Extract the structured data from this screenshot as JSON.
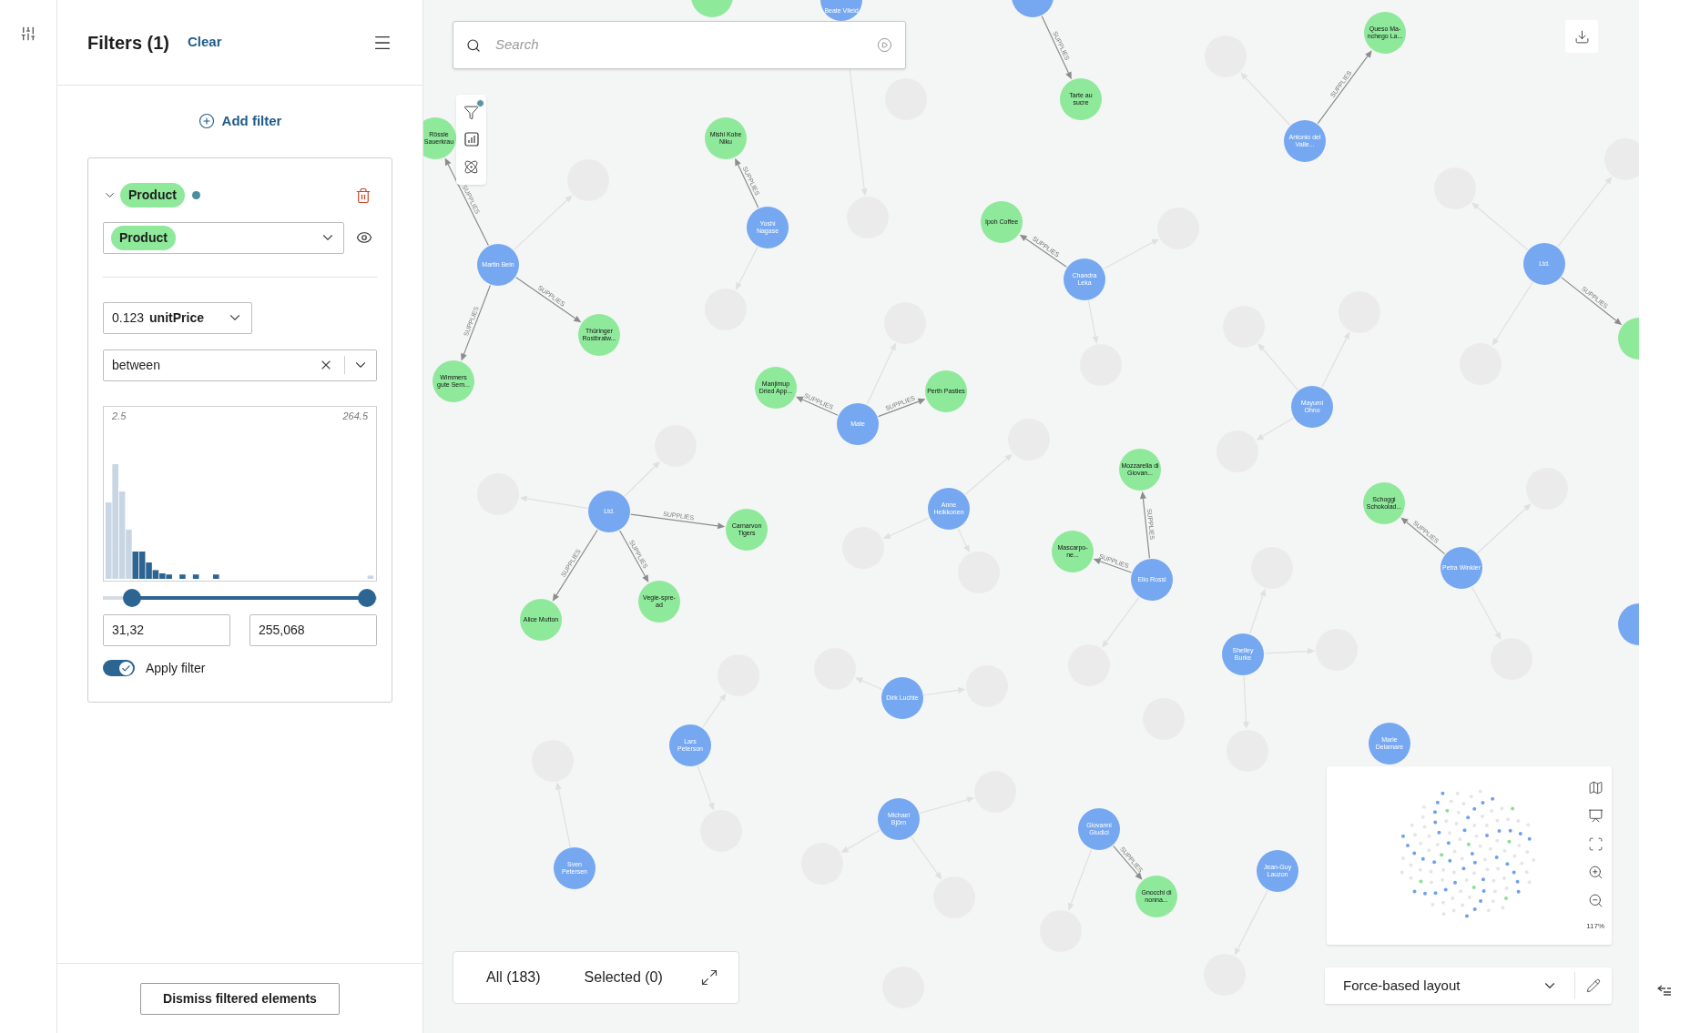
{
  "filters_panel": {
    "title": "Filters (1)",
    "clear_link": "Clear",
    "add_filter": "Add filter",
    "filter": {
      "expanded": true,
      "label_badge": "Product",
      "active": true,
      "label_select": "Product",
      "property_type": "0.123",
      "property": "unitPrice",
      "operator": "between",
      "histogram": {
        "min_label": "2.5",
        "max_label": "264.5"
      },
      "slider": {
        "thumbs": [
          {
            "level": 0.106
          },
          {
            "level": 0.965
          }
        ]
      },
      "min_value": "31,32",
      "max_value": "255,068",
      "apply_filter": {
        "label": "Apply filter",
        "on": true
      }
    },
    "dismiss_button": "Dismiss filtered elements"
  },
  "search": {
    "placeholder": "Search"
  },
  "toolbar": {
    "filter_badge": true
  },
  "graph": {
    "nodes": [
      {
        "kind": "product"
      },
      {
        "kind": "supplier"
      },
      {
        "label": "Beate Vileid",
        "kind": "supplier"
      },
      {
        "label": "Queso Ma-nchego La...",
        "kind": "product"
      },
      {
        "label": "Tarte au sucre",
        "kind": "product"
      },
      {
        "label": "Rössle Sauerkrau",
        "kind": "product"
      },
      {
        "label": "Mishi Kobe Niku",
        "kind": "product"
      },
      {
        "label": "Antonio del Valle...",
        "kind": "supplier"
      },
      {
        "label": "Yoshi Nagase",
        "kind": "supplier"
      },
      {
        "label": "Ipoh Coffee",
        "kind": "product"
      },
      {
        "label": "Ltd.",
        "kind": "supplier"
      },
      {
        "label": "Martin Bein",
        "kind": "supplier"
      },
      {
        "label": "Chandra Leka",
        "kind": "supplier"
      },
      {
        "label": "Thüringer Rostbratw...",
        "kind": "product"
      },
      {
        "kind": "product"
      },
      {
        "label": "Wimmers gute Sem...",
        "kind": "product"
      },
      {
        "label": "Manjimup Dried App...",
        "kind": "product"
      },
      {
        "label": "Perth Pasties",
        "kind": "product"
      },
      {
        "label": "Mayumi Ohno",
        "kind": "supplier"
      },
      {
        "label": "Mate",
        "kind": "supplier"
      },
      {
        "label": "Mozzarella di Giovan...",
        "kind": "product"
      },
      {
        "label": "Anne Heikkonen",
        "kind": "supplier"
      },
      {
        "label": "Schoggi Schokolad...",
        "kind": "product"
      },
      {
        "label": "Ltd.",
        "kind": "supplier"
      },
      {
        "label": "Carnarvon Tigers",
        "kind": "product"
      },
      {
        "label": "Mascarpo-ne...",
        "kind": "product"
      },
      {
        "label": "Petra Winkler",
        "kind": "supplier"
      },
      {
        "label": "Elio Rossi",
        "kind": "supplier"
      },
      {
        "label": "Vegie-spre-ad",
        "kind": "product"
      },
      {
        "label": "Alice Mutton",
        "kind": "product"
      },
      {
        "kind": "supplier"
      },
      {
        "label": "Shelley Burke",
        "kind": "supplier"
      },
      {
        "label": "Dirk Luchte",
        "kind": "supplier"
      },
      {
        "label": "Lars Peterson",
        "kind": "supplier"
      },
      {
        "label": "Marie Delamare",
        "kind": "supplier"
      },
      {
        "label": "Michael Björn",
        "kind": "supplier"
      },
      {
        "label": "Giovanni Giudici",
        "kind": "supplier"
      },
      {
        "label": "Sven Petersen",
        "kind": "supplier"
      },
      {
        "label": "Jean-Guy Lauzon",
        "kind": "supplier"
      },
      {
        "label": "Gnocchi di nonna...",
        "kind": "product"
      },
      {
        "kind": "faded"
      },
      {
        "kind": "faded"
      },
      {
        "kind": "faded"
      },
      {
        "kind": "faded"
      },
      {
        "kind": "faded"
      },
      {
        "kind": "faded"
      },
      {
        "kind": "faded"
      },
      {
        "kind": "faded"
      },
      {
        "kind": "faded"
      },
      {
        "kind": "faded"
      },
      {
        "kind": "faded"
      },
      {
        "kind": "faded"
      },
      {
        "kind": "faded"
      },
      {
        "kind": "faded"
      },
      {
        "kind": "faded"
      },
      {
        "kind": "faded"
      },
      {
        "kind": "faded"
      },
      {
        "kind": "faded"
      },
      {
        "kind": "faded"
      },
      {
        "kind": "faded"
      },
      {
        "kind": "faded"
      },
      {
        "kind": "faded"
      },
      {
        "kind": "faded"
      },
      {
        "kind": "faded"
      },
      {
        "kind": "faded"
      },
      {
        "kind": "faded"
      },
      {
        "kind": "faded"
      },
      {
        "kind": "faded"
      },
      {
        "kind": "faded"
      },
      {
        "kind": "faded"
      },
      {
        "kind": "faded"
      },
      {
        "kind": "faded"
      },
      {
        "kind": "faded"
      },
      {
        "kind": "faded"
      },
      {
        "kind": "faded"
      },
      {
        "kind": "faded"
      },
      {
        "kind": "faded"
      }
    ],
    "edges": [
      {
        "label": "SUPPLIES",
        "faded": false
      },
      {
        "label": "SUPPLIES",
        "faded": false
      },
      {
        "label": "SUPPLIES",
        "faded": false
      },
      {
        "label": "SUPPLIES",
        "faded": false
      },
      {
        "label": "SUPPLIES",
        "faded": false
      },
      {
        "label": "SUPPLIES",
        "faded": false
      },
      {
        "label": "SUPPLIES",
        "faded": false
      },
      {
        "label": "SUPPLIES",
        "faded": false
      },
      {
        "label": "SUPPLIES",
        "faded": false
      },
      {
        "label": "SUPPLIES",
        "faded": false
      },
      {
        "label": "SUPPLIES",
        "faded": false
      },
      {
        "label": "SUPPLIES",
        "faded": false
      },
      {
        "label": "SUPPLIES",
        "faded": false
      },
      {
        "label": "SUPPLIES",
        "faded": false
      },
      {
        "label": "SUPPLIES",
        "faded": false
      },
      {
        "label": "SUPPLIES",
        "faded": false
      },
      {
        "label": "SUPPLIES",
        "faded": false
      },
      {
        "faded": true
      },
      {
        "faded": true
      },
      {
        "faded": true
      },
      {
        "faded": true
      },
      {
        "faded": true
      },
      {
        "faded": true
      },
      {
        "faded": true
      },
      {
        "faded": true
      },
      {
        "faded": true
      },
      {
        "faded": true
      },
      {
        "faded": true
      },
      {
        "faded": true
      },
      {
        "faded": true
      },
      {
        "faded": true
      },
      {
        "faded": true
      },
      {
        "faded": true
      },
      {
        "faded": true
      },
      {
        "faded": true
      },
      {
        "faded": true
      },
      {
        "faded": true
      },
      {
        "faded": true
      },
      {
        "faded": true
      },
      {
        "faded": true
      },
      {
        "faded": true
      },
      {
        "faded": true
      },
      {
        "faded": true
      },
      {
        "faded": true
      },
      {
        "faded": true
      },
      {
        "faded": true
      },
      {
        "faded": true
      },
      {
        "faded": true
      },
      {
        "faded": true
      },
      {
        "faded": true
      },
      {
        "faded": true
      }
    ]
  },
  "selection_bar": {
    "all": "All (183)",
    "selected": "Selected (0)"
  },
  "minimap": {
    "zoom": "117%"
  },
  "layout_select": {
    "value": "Force-based layout"
  }
}
